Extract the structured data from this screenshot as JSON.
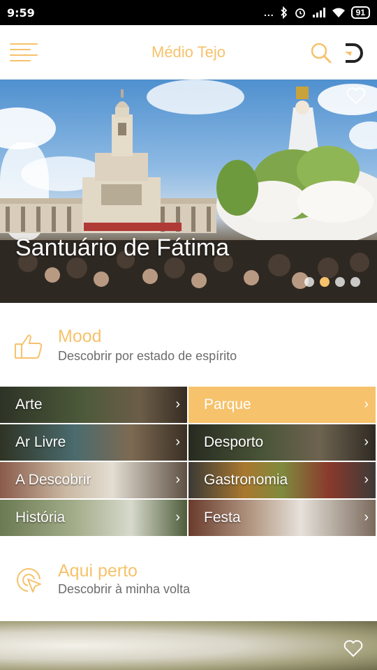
{
  "status_bar": {
    "time": "9:59",
    "dots": "...",
    "battery": "91"
  },
  "header": {
    "title": "Médio Tejo"
  },
  "hero": {
    "title": "Santuário de Fátima",
    "carousel_index": 2,
    "carousel_total": 4
  },
  "mood": {
    "title": "Mood",
    "subtitle": "Descobrir por estado de espírito"
  },
  "categories": [
    {
      "label": "Arte"
    },
    {
      "label": "Parque"
    },
    {
      "label": "Ar Livre"
    },
    {
      "label": "Desporto"
    },
    {
      "label": "A Descobrir"
    },
    {
      "label": "Gastronomia"
    },
    {
      "label": "História"
    },
    {
      "label": "Festa"
    }
  ],
  "nearby": {
    "title": "Aqui perto",
    "subtitle": "Descobrir à minha volta"
  },
  "colors": {
    "accent": "#f6c26b",
    "status_bar": "#000000",
    "subtitle_text": "#6b6b6b"
  },
  "icons": {
    "menu": "menu-icon",
    "search": "search-icon",
    "logo": "logo-icon",
    "heart": "heart-icon",
    "mood": "thumbs-up-icon",
    "nearby": "location-cursor-icon",
    "chevron": "chevron-right-icon"
  }
}
